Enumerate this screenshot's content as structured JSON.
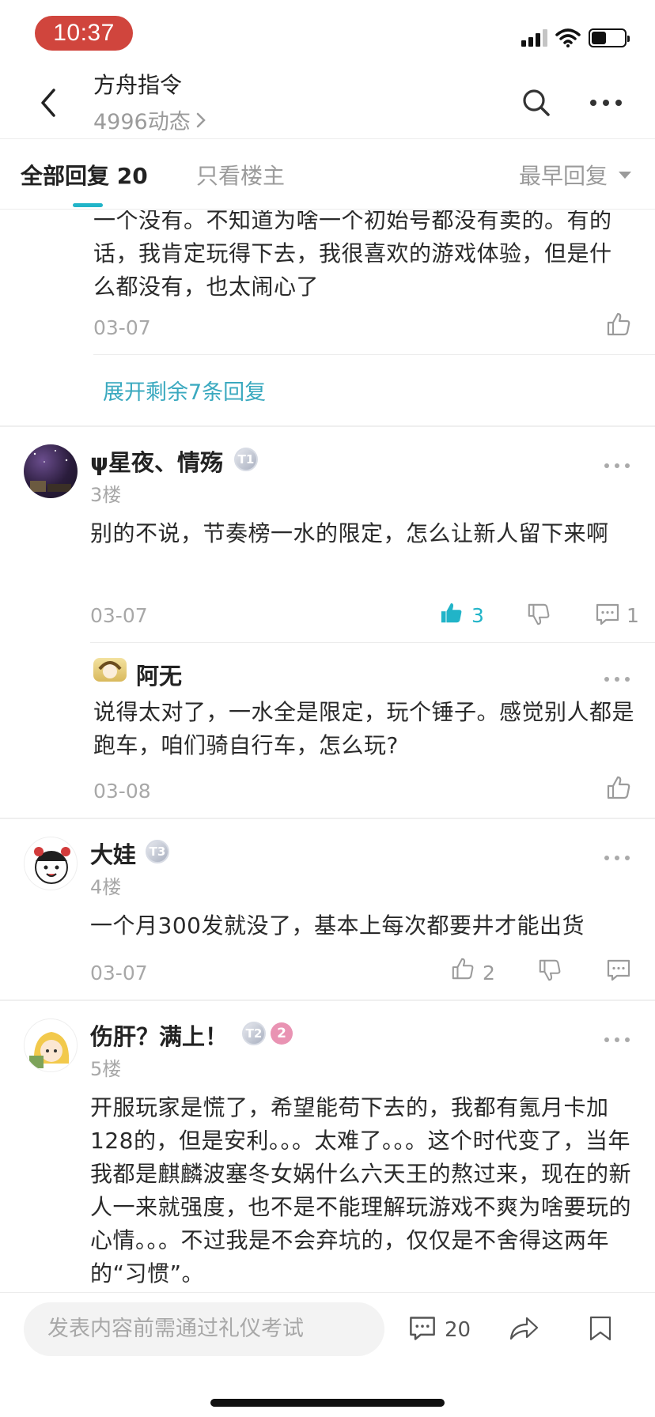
{
  "status_bar": {
    "time": "10:37",
    "battery_level": 0.45
  },
  "header": {
    "title": "方舟指令",
    "subtitle": "4996动态",
    "subtitle_chevron_icon": "chevron-right-icon"
  },
  "tabs": {
    "all_label": "全部回复 20",
    "owner_only_label": "只看楼主",
    "sort_label": "最早回复"
  },
  "colors": {
    "accent": "#21b4c8",
    "time_pill": "#d0453d",
    "level2_badge": "#e993b3"
  },
  "thread": {
    "prev_reply": {
      "text": "一个没有。不知道为啥一个初始号都没有卖的。有的话，我肯定玩得下去，我很喜欢的游戏体验，但是什么都没有，也太闹心了",
      "date": "03-07"
    },
    "expand_label": "展开剩余7条回复",
    "comments": [
      {
        "name": "ψ星夜、情殇",
        "badge": "T1",
        "floor": "3楼",
        "text": "别的不说，节奏榜一水的限定，怎么让新人留下来啊",
        "date": "03-07",
        "likes": "3",
        "replies": "1",
        "sub_reply": {
          "name": "阿无",
          "text": "说得太对了，一水全是限定，玩个锤子。感觉别人都是跑车，咱们骑自行车，怎么玩?",
          "date": "03-08"
        }
      },
      {
        "name": "大娃",
        "badge": "T3",
        "floor": "4楼",
        "text": "一个月300发就没了，基本上每次都要井才能出货",
        "date": "03-07",
        "likes": "2"
      },
      {
        "name": "伤肝？满上！",
        "badge": "T2",
        "level": "2",
        "floor": "5楼",
        "text": "开服玩家是慌了，希望能苟下去的，我都有氪月卡加128的，但是安利。。。太难了。。。这个时代变了，当年我都是麒麟波塞冬女娲什么六天王的熬过来，现在的新人一来就强度，也不是不能理解玩游戏不爽为啥要玩的心情。。。不过我是不会弃坑的，仅仅是不舍得这两年的“习惯”。"
      }
    ]
  },
  "bottom_bar": {
    "composer_placeholder": "发表内容前需通过礼仪考试",
    "comment_count": "20"
  }
}
